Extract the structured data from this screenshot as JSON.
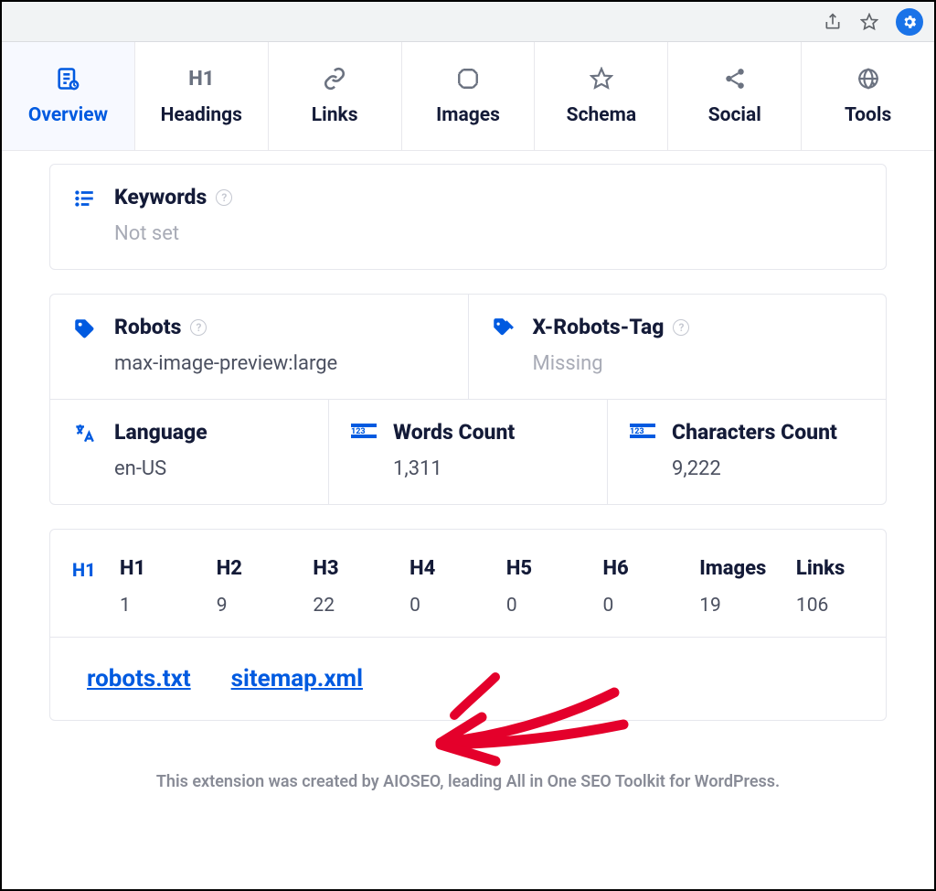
{
  "tabs": {
    "overview": "Overview",
    "headings": "Headings",
    "links": "Links",
    "images": "Images",
    "schema": "Schema",
    "social": "Social",
    "tools": "Tools"
  },
  "keywords": {
    "title": "Keywords",
    "value": "Not set"
  },
  "robots": {
    "title": "Robots",
    "value": "max-image-preview:large"
  },
  "xrobots": {
    "title": "X-Robots-Tag",
    "value": "Missing"
  },
  "language": {
    "title": "Language",
    "value": "en-US"
  },
  "words": {
    "title": "Words Count",
    "value": "1,311"
  },
  "chars": {
    "title": "Characters Count",
    "value": "9,222"
  },
  "counts": {
    "h1": {
      "label": "H1",
      "value": "1"
    },
    "h2": {
      "label": "H2",
      "value": "9"
    },
    "h3": {
      "label": "H3",
      "value": "22"
    },
    "h4": {
      "label": "H4",
      "value": "0"
    },
    "h5": {
      "label": "H5",
      "value": "0"
    },
    "h6": {
      "label": "H6",
      "value": "0"
    },
    "images": {
      "label": "Images",
      "value": "19"
    },
    "links": {
      "label": "Links",
      "value": "106"
    }
  },
  "quicklinks": {
    "robots_txt": "robots.txt",
    "sitemap_xml": "sitemap.xml"
  },
  "footer": "This extension was created by AIOSEO, leading All in One SEO Toolkit for WordPress."
}
